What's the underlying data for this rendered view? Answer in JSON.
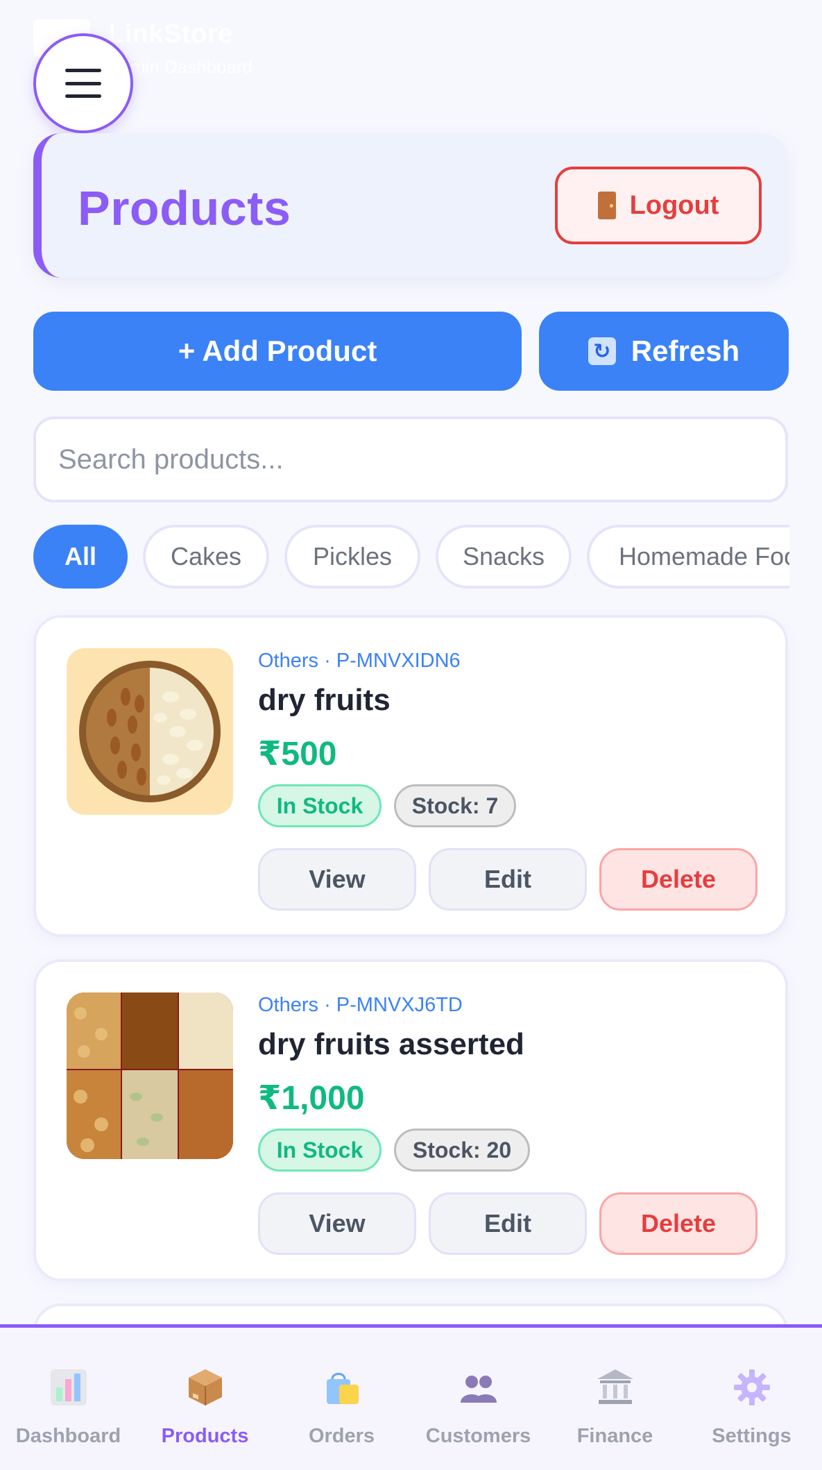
{
  "app": {
    "name": "LinkStore",
    "tagline": "Admin Dashboard"
  },
  "header": {
    "title": "Products",
    "logout_label": "Logout"
  },
  "toolbar": {
    "add_label": "+ Add Product",
    "refresh_label": "Refresh"
  },
  "search": {
    "placeholder": "Search products...",
    "value": ""
  },
  "categories": [
    {
      "label": "All",
      "active": true
    },
    {
      "label": "Cakes",
      "active": false
    },
    {
      "label": "Pickles",
      "active": false
    },
    {
      "label": "Snacks",
      "active": false
    },
    {
      "label": "Homemade Food",
      "active": false
    }
  ],
  "products": [
    {
      "meta": "Others · P-MNVXIDN6",
      "name": "dry fruits",
      "price": "₹500",
      "status": "In Stock",
      "stock": "Stock: 7",
      "view_label": "View",
      "edit_label": "Edit",
      "delete_label": "Delete"
    },
    {
      "meta": "Others · P-MNVXJ6TD",
      "name": "dry fruits asserted",
      "price": "₹1,000",
      "status": "In Stock",
      "stock": "Stock: 20",
      "view_label": "View",
      "edit_label": "Edit",
      "delete_label": "Delete"
    }
  ],
  "bottom_nav": [
    {
      "label": "Dashboard",
      "icon": "chart-icon",
      "active": false
    },
    {
      "label": "Products",
      "icon": "package-icon",
      "active": true
    },
    {
      "label": "Orders",
      "icon": "shopping-bag-icon",
      "active": false
    },
    {
      "label": "Customers",
      "icon": "users-icon",
      "active": false
    },
    {
      "label": "Finance",
      "icon": "bank-icon",
      "active": false
    },
    {
      "label": "Settings",
      "icon": "gear-icon",
      "active": false
    }
  ],
  "colors": {
    "accent": "#8b5cf6",
    "primary": "#3b82f6",
    "danger": "#e53e3e",
    "success": "#10b981"
  }
}
